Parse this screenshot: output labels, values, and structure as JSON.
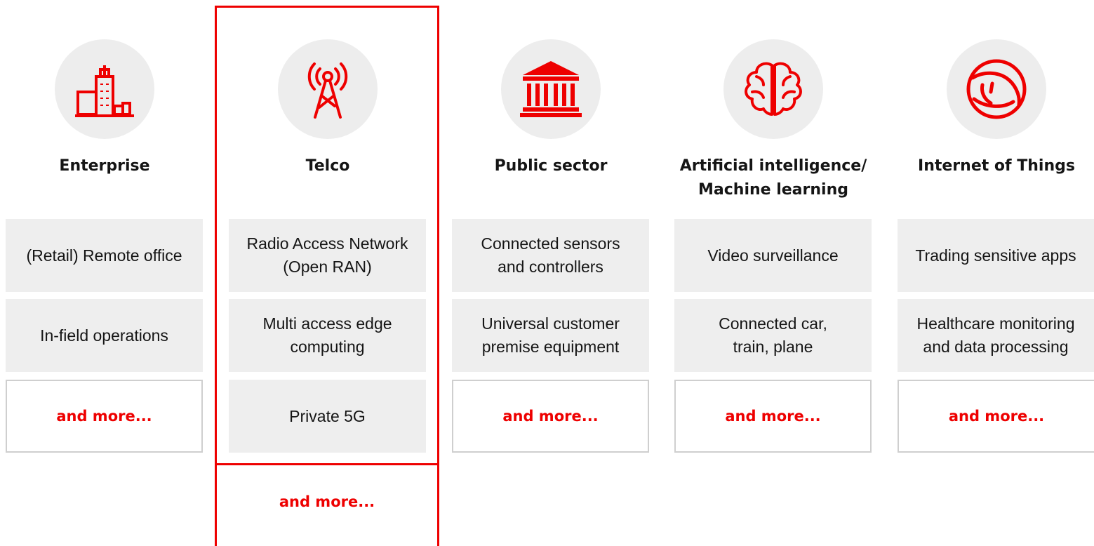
{
  "accent_color": "#ee0000",
  "columns": [
    {
      "icon": "building-icon",
      "title": "Enterprise",
      "items": [
        "(Retail) Remote office",
        "In-field operations"
      ],
      "more": "and more..."
    },
    {
      "icon": "cell-tower-icon",
      "title": "Telco",
      "items": [
        "Radio Access Network\n(Open RAN)",
        "Multi access edge\ncomputing",
        "Private 5G"
      ],
      "more": "and more..."
    },
    {
      "icon": "government-building-icon",
      "title": "Public sector",
      "items": [
        "Connected sensors\nand controllers",
        "Universal customer\npremise equipment"
      ],
      "more": "and more..."
    },
    {
      "icon": "brain-icon",
      "title": "Artificial intelligence/\nMachine learning",
      "items": [
        "Video surveillance",
        "Connected car,\ntrain, plane"
      ],
      "more": "and more..."
    },
    {
      "icon": "globe-icon",
      "title": "Internet of Things",
      "items": [
        "Trading sensitive apps",
        "Healthcare monitoring\nand data processing"
      ],
      "more": "and more..."
    }
  ]
}
